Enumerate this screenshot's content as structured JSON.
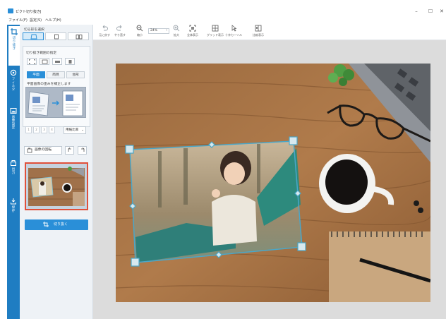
{
  "window": {
    "title": "ピクト切り抜きJ",
    "controls": {
      "minimize": "–",
      "maximize": "☐",
      "close": "✕"
    }
  },
  "menu": {
    "items": [
      "ファイル(F)",
      "設定(S)",
      "ヘルプ(H)"
    ]
  },
  "sidebar_tabs": [
    {
      "label": "切り抜き",
      "icon": "crop-icon",
      "active": true
    },
    {
      "label": "フィルタ",
      "icon": "filter-icon",
      "active": false
    },
    {
      "label": "画像設定",
      "icon": "image-settings-icon",
      "active": false
    },
    {
      "label": "出力",
      "icon": "output-icon",
      "active": false
    },
    {
      "label": "保存",
      "icon": "save-icon",
      "active": false
    }
  ],
  "panel": {
    "shape_heading": "切る形を選択",
    "range_heading": "切り抜き範囲の指定",
    "mode_tabs": [
      "平面",
      "両見",
      "台形"
    ],
    "active_mode": 0,
    "mode_description": "平面画像の歪みを補正します",
    "stepper_values": [
      "1",
      "2",
      "3",
      "4"
    ],
    "ratio_select": "用紙比率",
    "rotate_label": "画像の回転",
    "crop_button": "切り抜く"
  },
  "toolbar": {
    "tools": [
      {
        "label": "元に戻す",
        "icon": "undo-icon"
      },
      {
        "label": "やり直す",
        "icon": "redo-icon"
      },
      {
        "label": "縮小",
        "icon": "zoom-out-icon"
      },
      {
        "label": "拡大",
        "icon": "zoom-in-icon"
      },
      {
        "label": "全体表示",
        "icon": "fit-icon"
      },
      {
        "label": "グリッド表示",
        "icon": "grid-icon"
      },
      {
        "label": "十字カーソル",
        "icon": "cursor-icon"
      },
      {
        "label": "比較表示",
        "icon": "compare-icon"
      }
    ],
    "zoom_value": "24%"
  },
  "colors": {
    "accent": "#2a8fd8",
    "tab_strip": "#1f7dc2",
    "panel_bg": "#eef2f6",
    "canvas_bg": "#dcdcdc",
    "crop_handle": "#4aa7c9",
    "selection_border": "#e0503a"
  }
}
